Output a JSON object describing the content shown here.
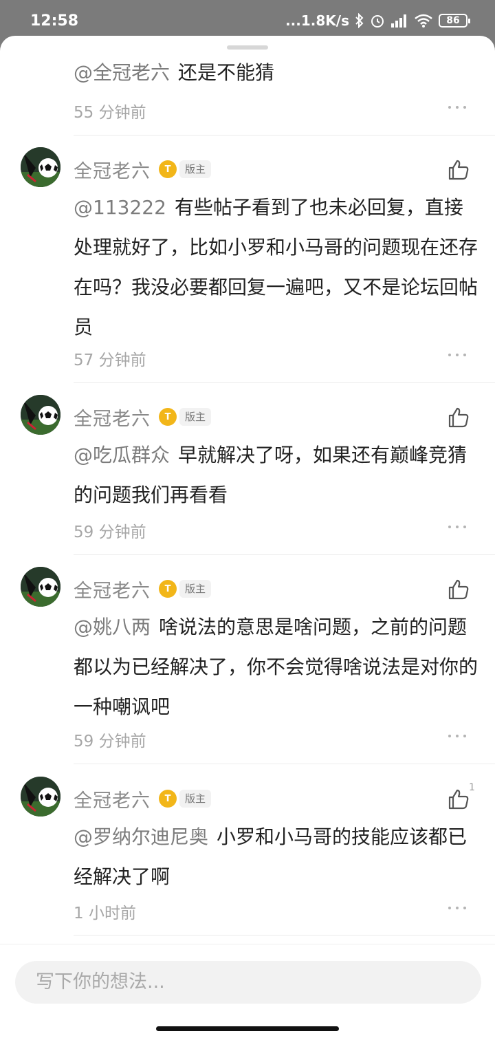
{
  "status_bar": {
    "time": "12:58",
    "net_speed": "...1.8K/s",
    "battery": "86",
    "icons": [
      "bluetooth-icon",
      "alarm-icon",
      "signal-icon",
      "wifi-icon",
      "battery-icon"
    ]
  },
  "comments": [
    {
      "mention": "@全冠老六",
      "text": "还是不能猜",
      "time": "55 分钟前",
      "partial": true
    },
    {
      "name": "全冠老六",
      "level_badge": "T",
      "role_badge": "版主",
      "mention": "@113222",
      "text": "有些帖子看到了也未必回复，直接处理就好了，比如小罗和小马哥的问题现在还存在吗？我没必要都回复一遍吧，又不是论坛回帖员",
      "time": "57 分钟前",
      "likes": ""
    },
    {
      "name": "全冠老六",
      "level_badge": "T",
      "role_badge": "版主",
      "mention": "@吃瓜群众",
      "text": "早就解决了呀，如果还有巅峰竞猜的问题我们再看看",
      "time": "59 分钟前",
      "likes": ""
    },
    {
      "name": "全冠老六",
      "level_badge": "T",
      "role_badge": "版主",
      "mention": "@姚八两",
      "text": "啥说法的意思是啥问题，之前的问题都以为已经解决了，你不会觉得啥说法是对你的一种嘲讽吧",
      "time": "59 分钟前",
      "likes": ""
    },
    {
      "name": "全冠老六",
      "level_badge": "T",
      "role_badge": "版主",
      "mention": "@罗纳尔迪尼奥",
      "text": "小罗和小马哥的技能应该都已经解决了啊",
      "time": "1 小时前",
      "likes": "1"
    }
  ],
  "input": {
    "placeholder": "写下你的想法..."
  },
  "colors": {
    "level_badge": "#f2b619",
    "mention": "#7c7c7c",
    "meta": "#a6a6a6"
  }
}
